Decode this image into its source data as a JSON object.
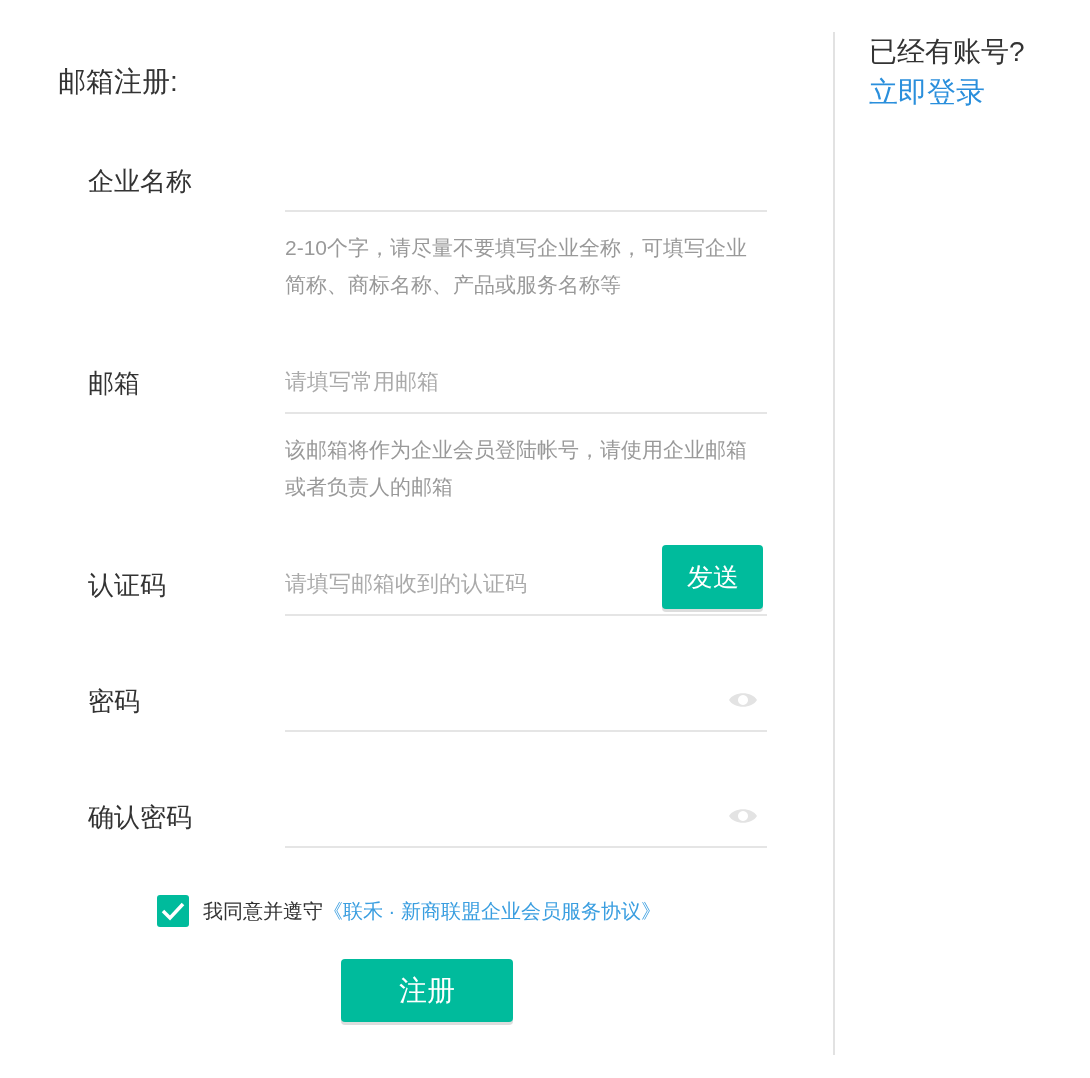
{
  "form": {
    "title": "邮箱注册:",
    "fields": [
      {
        "label": "企业名称",
        "kind": "text",
        "hint": "2-10个字，请尽量不要填写企业全称，可填写企业简称、商标名称、产品或服务名称等"
      },
      {
        "label": "邮箱",
        "kind": "text",
        "placeholder": "请填写常用邮箱",
        "hint": "该邮箱将作为企业会员登陆帐号，请使用企业邮箱或者负责人的邮箱"
      },
      {
        "label": "认证码",
        "kind": "code",
        "placeholder": "请填写邮箱收到的认证码",
        "button": "发送"
      },
      {
        "label": "密码",
        "kind": "password"
      },
      {
        "label": "确认密码",
        "kind": "password"
      }
    ],
    "agreement": {
      "checked": true,
      "text": "我同意并遵守",
      "link": "《联禾 · 新商联盟企业会员服务协议》"
    },
    "submit": "注册"
  },
  "side": {
    "prompt": "已经有账号?",
    "link": "立即登录"
  }
}
